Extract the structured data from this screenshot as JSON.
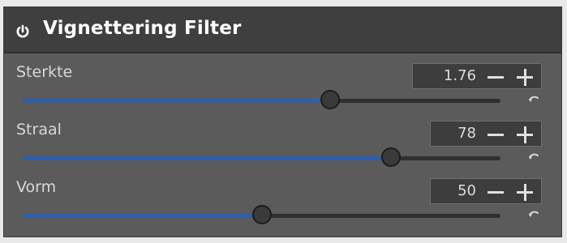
{
  "panel": {
    "title": "Vignettering Filter",
    "power_icon": "power-icon"
  },
  "rows": [
    {
      "label": "Sterkte",
      "value": "1.76",
      "fraction": 0.643,
      "reset_icon": "undo-arrow-icon"
    },
    {
      "label": "Straal",
      "value": "78",
      "fraction": 0.77,
      "reset_icon": "undo-arrow-icon"
    },
    {
      "label": "Vorm",
      "value": "50",
      "fraction": 0.5,
      "reset_icon": "undo-arrow-icon"
    }
  ],
  "colors": {
    "accent": "#2c5fae",
    "panel": "#5b5b5b",
    "header": "#3f3f3f"
  }
}
